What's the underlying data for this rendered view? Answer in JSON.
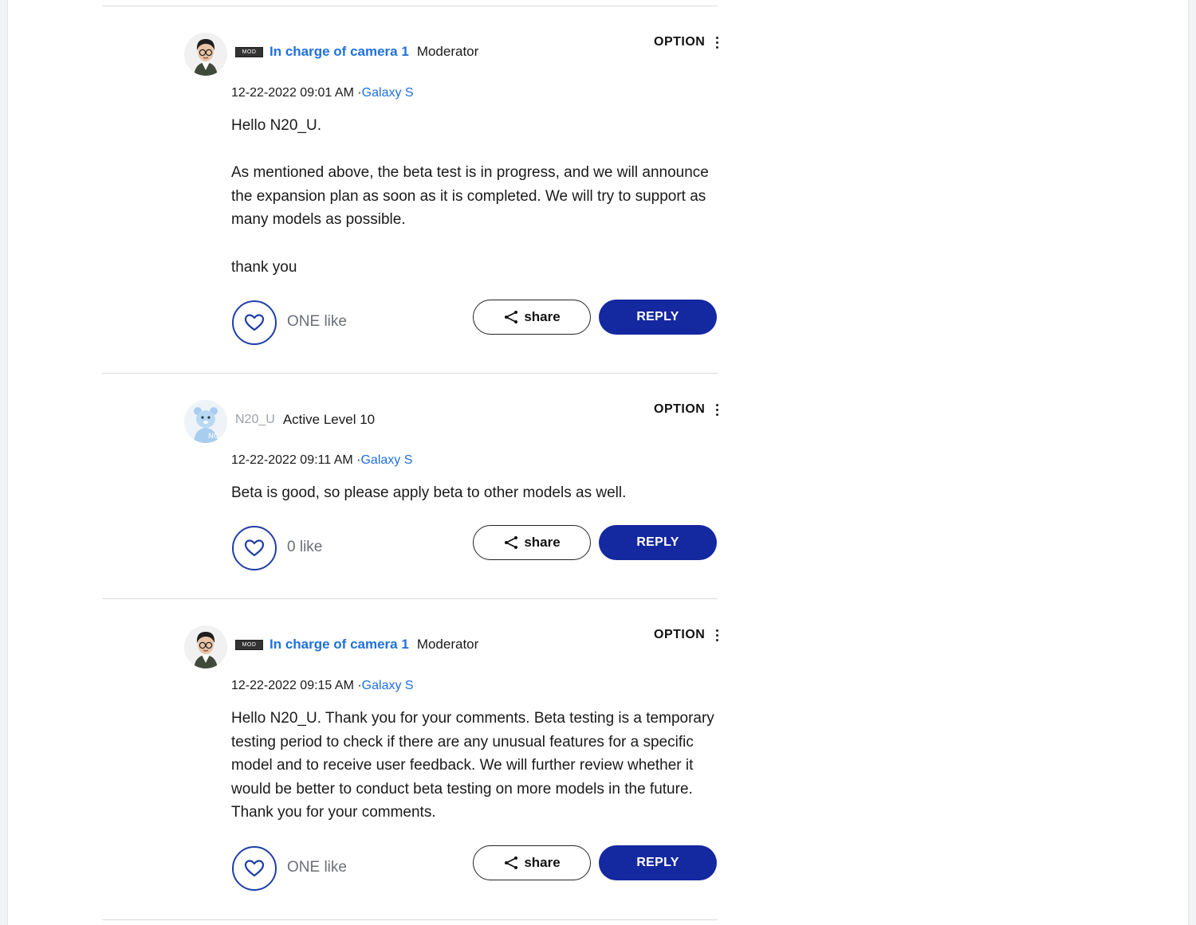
{
  "theme": {
    "link_color": "#2171d9",
    "reply_button_color": "#1428a0",
    "like_ring_color": "#1f3fa6"
  },
  "posts": [
    {
      "avatar_icon": "moderator-avatar",
      "badge": "MOD",
      "author": "In charge of camera 1",
      "rank": "Moderator",
      "option_label": "OPTION",
      "date": "12-22-2022 09:01 AM",
      "board_prefix": "·",
      "board": "Galaxy S",
      "paragraphs": [
        "Hello N20_U.",
        "As mentioned above, the beta test is in progress, and we will announce the expansion plan as soon as it is completed. We will try to support as many models as possible.",
        "thank you"
      ],
      "like_count": "ONE like",
      "share_label": "share",
      "reply_label": "REPLY"
    },
    {
      "avatar_icon": "bear-avatar",
      "author": "N20_U",
      "rank": "Active Level 10",
      "option_label": "OPTION",
      "date": "12-22-2022 09:11 AM",
      "board_prefix": "·",
      "board": "Galaxy S",
      "paragraphs": [
        "Beta is good, so please apply beta to other models as well."
      ],
      "like_count": "0 like",
      "share_label": "share",
      "reply_label": "REPLY"
    },
    {
      "avatar_icon": "moderator-avatar",
      "badge": "MOD",
      "author": "In charge of camera 1",
      "rank": "Moderator",
      "option_label": "OPTION",
      "date": "12-22-2022 09:15 AM",
      "board_prefix": "·",
      "board": "Galaxy S",
      "paragraphs": [
        "Hello N20_U. Thank you for your comments. Beta testing is a temporary testing period to check if there are any unusual features for a specific model and to receive user feedback. We will further review whether it would be better to conduct beta testing on more models in the future. Thank you for your comments."
      ],
      "like_count": "ONE like",
      "share_label": "share",
      "reply_label": "REPLY"
    }
  ]
}
